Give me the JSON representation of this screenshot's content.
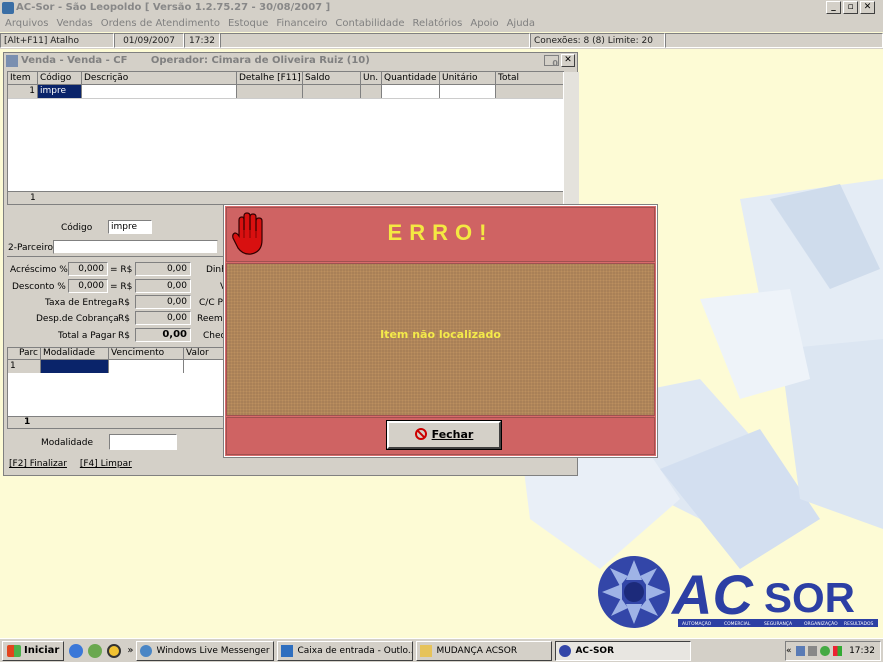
{
  "app": {
    "title": "AC-Sor - São Leopoldo  [ Versão 1.2.75.27 - 30/08/2007 ]",
    "window_buttons": [
      "_",
      "▫",
      "✕"
    ]
  },
  "menu": [
    "Arquivos",
    "Vendas",
    "Ordens de Atendimento",
    "Estoque",
    "Financeiro",
    "Contabilidade",
    "Relatórios",
    "Apoio",
    "Ajuda"
  ],
  "status": {
    "shortcut": "[Alt+F11] Atalho",
    "date": "01/09/2007",
    "time": "17:32",
    "connections": "Conexões: 8 (8)  Limite: 20"
  },
  "sale_window": {
    "title": "Venda - Venda - CF",
    "operator": "Operador: Cimara de Oliveira Ruiz  (10)",
    "mini_value": "0",
    "close": "✕",
    "items_grid": {
      "columns": [
        "Item",
        "Código",
        "Descrição",
        "Detalhe [F11]",
        "Saldo",
        "Un.",
        "Quantidade",
        "Unitário",
        "Total"
      ],
      "row": [
        "1",
        "impre",
        "",
        "",
        "",
        "",
        "",
        "",
        ""
      ],
      "footer_count": "1"
    },
    "codigo_label": "Código",
    "codigo_value": "impre",
    "parceiro_label": "2-Parceiro",
    "parceiro_value": "",
    "totals": [
      {
        "label": "Acréscimo %",
        "pct": "0,000",
        "rs_label": "= R$",
        "value": "0,00"
      },
      {
        "label": "Desconto %",
        "pct": "0,000",
        "rs_label": "= R$",
        "value": "0,00"
      },
      {
        "label": "Taxa de Entrega",
        "rs_label": "R$",
        "value": "0,00"
      },
      {
        "label": "Desp.de Cobrança",
        "rs_label": "R$",
        "value": "0,00"
      },
      {
        "label": "Total a Pagar",
        "rs_label": "R$",
        "value": "0,00"
      }
    ],
    "side_labels": [
      "Dinh",
      "V",
      "C/C P",
      "Reemb",
      "Chec"
    ],
    "payments_grid": {
      "columns": [
        "Parc",
        "Modalidade",
        "Vencimento",
        "Valor"
      ],
      "row": [
        "1",
        "",
        "",
        ""
      ],
      "footer_count": "1"
    },
    "modalidade_label": "Modalidade",
    "modalidade_value": "",
    "links": [
      "[F2] Finalizar",
      "[F4] Limpar"
    ]
  },
  "error_dialog": {
    "title": "ERRO!",
    "message": "Item não localizado",
    "button": "Fechar",
    "button_icon": "no-entry-icon",
    "head_icon": "stop-hand-icon"
  },
  "brand": {
    "name_ac": "AC",
    "name_sor": "SOR",
    "tagline": [
      "AUTOMAÇÃO",
      "COMERCIAL",
      "SEGURANÇA",
      "ORGANIZAÇÃO",
      "RESULTADOS"
    ]
  },
  "taskbar": {
    "start": "Iniciar",
    "chevron": "»",
    "items": [
      {
        "label": "Windows Live Messenger",
        "icon": "messenger-icon"
      },
      {
        "label": "Caixa de entrada - Outlo...",
        "icon": "outlook-icon"
      },
      {
        "label": "MUDANÇA ACSOR",
        "icon": "folder-icon"
      },
      {
        "label": "AC-SOR",
        "icon": "acsor-icon"
      }
    ],
    "tray_chevron": "«",
    "clock": "17:32"
  },
  "colors": {
    "desktop": "#fdfbd5",
    "error_red": "#cf6363",
    "error_text": "#f4e842",
    "brand_blue": "#2b3a9a"
  }
}
